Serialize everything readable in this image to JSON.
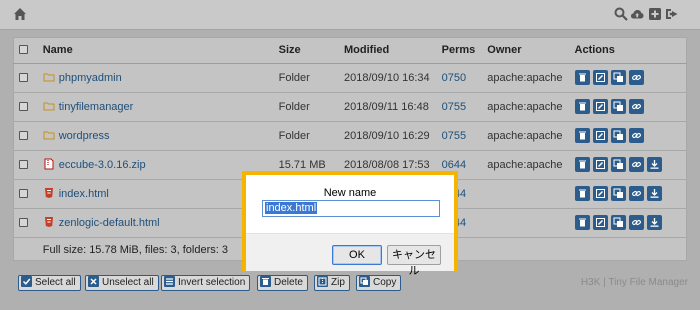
{
  "navbar": {
    "icons": [
      "home-icon",
      "search-icon",
      "upload-cloud-icon",
      "new-item-icon",
      "sign-out-icon"
    ]
  },
  "table": {
    "headers": {
      "name": "Name",
      "size": "Size",
      "modified": "Modified",
      "perms": "Perms",
      "owner": "Owner",
      "actions": "Actions"
    },
    "rows": [
      {
        "name": "phpmyadmin",
        "type": "folder",
        "size": "Folder",
        "modified": "2018/09/10 16:34",
        "perms": "0750",
        "owner": "apache:apache"
      },
      {
        "name": "tinyfilemanager",
        "type": "folder",
        "size": "Folder",
        "modified": "2018/09/11 16:48",
        "perms": "0755",
        "owner": "apache:apache"
      },
      {
        "name": "wordpress",
        "type": "folder",
        "size": "Folder",
        "modified": "2018/09/10 16:29",
        "perms": "0755",
        "owner": "apache:apache"
      },
      {
        "name": "eccube-3.0.16.zip",
        "type": "zip",
        "size": "15.71 MB",
        "modified": "2018/08/08 17:53",
        "perms": "0644",
        "owner": "apache:apache"
      },
      {
        "name": "index.html",
        "type": "html",
        "size": "",
        "modified": "",
        "perms": "0644",
        "owner": ""
      },
      {
        "name": "zenlogic-default.html",
        "type": "html",
        "size": "",
        "modified": "",
        "perms": "0644",
        "owner": ""
      }
    ],
    "summary": "Full size: 15.78 MiB, files: 3, folders: 3"
  },
  "bottom_buttons": {
    "select_all": "Select all",
    "unselect_all": "Unselect all",
    "invert_selection": "Invert selection",
    "delete": "Delete",
    "zip": "Zip",
    "copy": "Copy"
  },
  "brand": "H3K | Tiny File Manager",
  "dialog": {
    "title": "New name",
    "value": "index.html",
    "ok": "OK",
    "cancel": "キャンセル"
  },
  "colors": {
    "accent": "#2c5c8c",
    "highlight_border": "#f4b400",
    "link": "#1e4f7a",
    "selection": "#3a78d6"
  }
}
